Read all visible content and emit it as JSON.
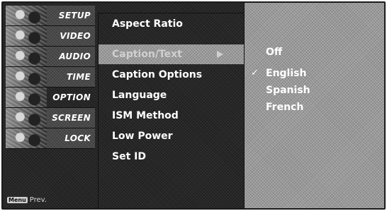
{
  "sidebar": {
    "categories": [
      {
        "label": "SETUP",
        "icon": "setup-thumbnail"
      },
      {
        "label": "VIDEO",
        "icon": "video-thumbnail"
      },
      {
        "label": "AUDIO",
        "icon": "audio-thumbnail"
      },
      {
        "label": "TIME",
        "icon": "time-thumbnail"
      },
      {
        "label": "OPTION",
        "icon": "option-thumbnail"
      },
      {
        "label": "SCREEN",
        "icon": "screen-thumbnail"
      },
      {
        "label": "LOCK",
        "icon": "lock-thumbnail"
      }
    ],
    "active_category": "OPTION",
    "menu_key": "Menu",
    "prev_label": "Prev."
  },
  "options": {
    "items": [
      {
        "label": "Aspect Ratio"
      },
      {
        "label": "Caption/Text"
      },
      {
        "label": "Caption Options"
      },
      {
        "label": "Language"
      },
      {
        "label": "ISM Method"
      },
      {
        "label": "Low Power"
      },
      {
        "label": "Set ID"
      }
    ],
    "selected_index": 1
  },
  "values": {
    "items": [
      {
        "label": "Off"
      },
      {
        "label": "English",
        "checked": true
      },
      {
        "label": "Spanish"
      },
      {
        "label": "French"
      }
    ],
    "check_glyph": "✓"
  },
  "colors": {
    "background": "#2a2a2a",
    "text": "#ffffff",
    "dim_text": "#d0d0d0"
  }
}
